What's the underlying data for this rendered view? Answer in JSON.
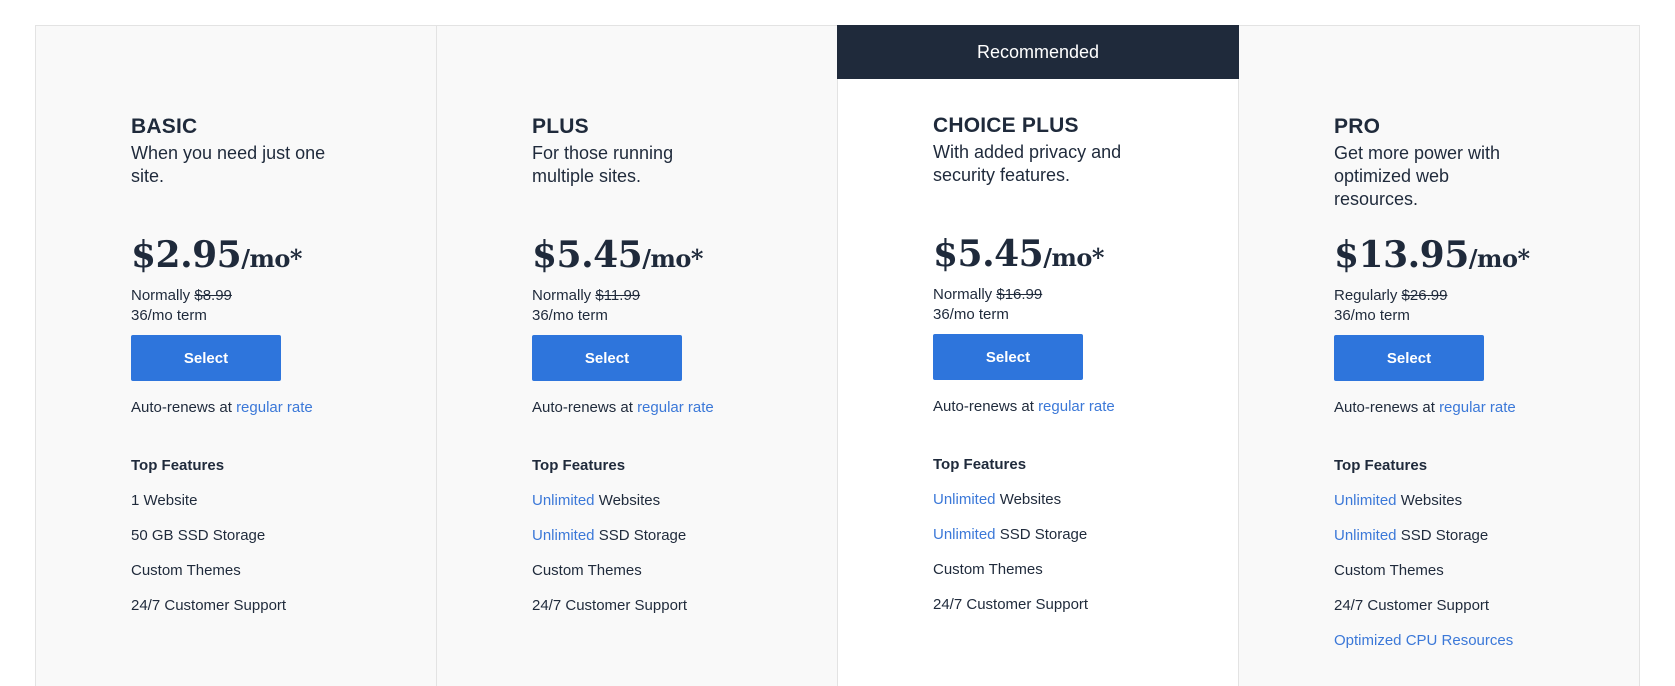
{
  "recommended_label": "Recommended",
  "top_features_label": "Top Features",
  "select_label": "Select",
  "renew_prefix": "Auto-renews at",
  "renew_link": "regular rate",
  "plans": [
    {
      "name": "BASIC",
      "tagline": "When you need just one site.",
      "price": "$2.95",
      "unit": "/mo*",
      "normal_prefix": "Normally",
      "normal_price": "$8.99",
      "term": "36/mo term",
      "features": [
        {
          "highlight": "",
          "text": "1 Website"
        },
        {
          "highlight": "",
          "text": "50 GB SSD Storage"
        },
        {
          "highlight": "",
          "text": "Custom Themes"
        },
        {
          "highlight": "",
          "text": "24/7 Customer Support"
        }
      ]
    },
    {
      "name": "PLUS",
      "tagline": "For those running multiple sites.",
      "price": "$5.45",
      "unit": "/mo*",
      "normal_prefix": "Normally",
      "normal_price": "$11.99",
      "term": "36/mo term",
      "features": [
        {
          "highlight": "Unlimited",
          "text": " Websites"
        },
        {
          "highlight": "Unlimited",
          "text": " SSD Storage"
        },
        {
          "highlight": "",
          "text": "Custom Themes"
        },
        {
          "highlight": "",
          "text": "24/7 Customer Support"
        }
      ]
    },
    {
      "name": "CHOICE PLUS",
      "tagline": "With added privacy and security features.",
      "price": "$5.45",
      "unit": "/mo*",
      "normal_prefix": "Normally",
      "normal_price": "$16.99",
      "term": "36/mo term",
      "recommended": true,
      "features": [
        {
          "highlight": "Unlimited",
          "text": " Websites"
        },
        {
          "highlight": "Unlimited",
          "text": " SSD Storage"
        },
        {
          "highlight": "",
          "text": "Custom Themes"
        },
        {
          "highlight": "",
          "text": "24/7 Customer Support"
        }
      ]
    },
    {
      "name": "PRO",
      "tagline": "Get more power with optimized web resources.",
      "price": "$13.95",
      "unit": "/mo*",
      "normal_prefix": "Regularly",
      "normal_price": "$26.99",
      "term": "36/mo term",
      "features": [
        {
          "highlight": "Unlimited",
          "text": " Websites"
        },
        {
          "highlight": "Unlimited",
          "text": " SSD Storage"
        },
        {
          "highlight": "",
          "text": "Custom Themes"
        },
        {
          "highlight": "",
          "text": "24/7 Customer Support"
        },
        {
          "highlight": "Optimized CPU Resources",
          "text": ""
        }
      ]
    }
  ],
  "colors": {
    "navy": "#1f2a3b",
    "button": "#2e75dc",
    "link": "#3b78d8"
  }
}
